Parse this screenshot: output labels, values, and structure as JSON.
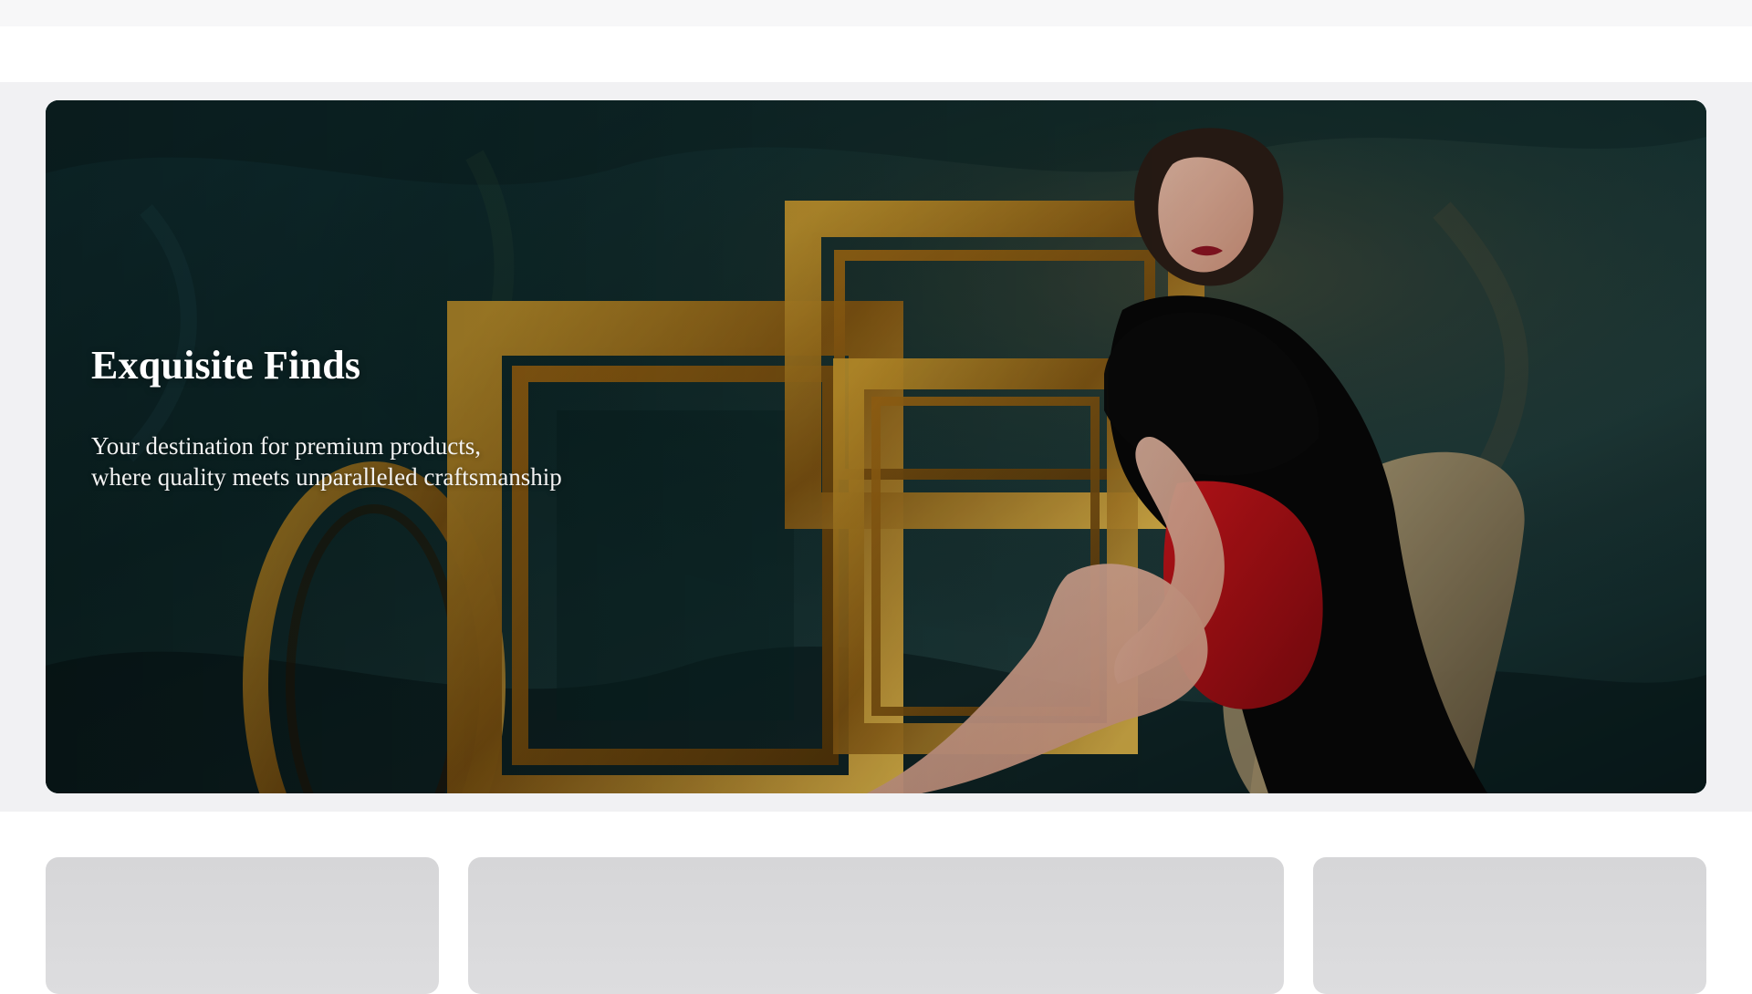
{
  "hero": {
    "title": "Exquisite Finds",
    "subtitle_line1": "Your destination for premium products,",
    "subtitle_line2": "where quality meets unparalleled craftsmanship",
    "image_icon": "hero-fashion-photo"
  },
  "colors": {
    "page_background": "#ffffff",
    "section_background": "#f1f1f3",
    "placeholder_card": "#d9d9db",
    "hero_text": "#ffffff"
  },
  "cards": {
    "count": 3
  }
}
